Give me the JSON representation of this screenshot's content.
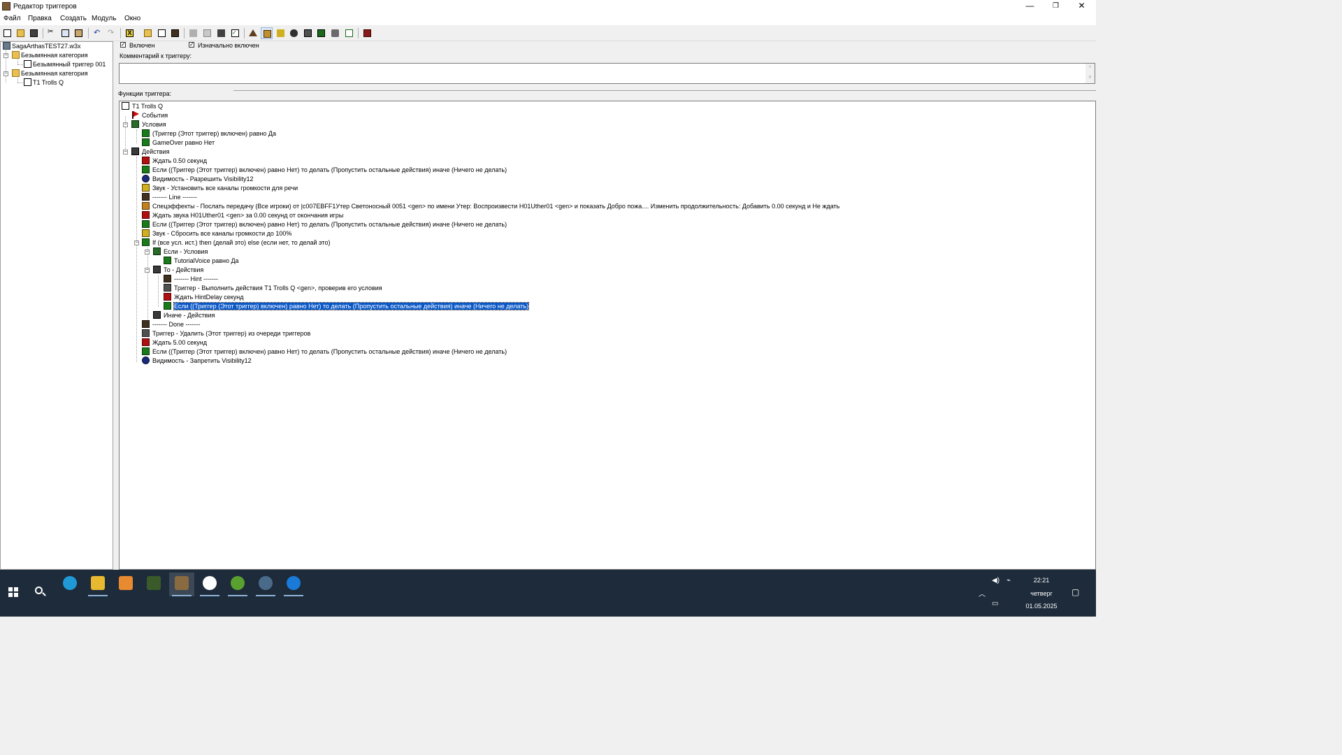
{
  "window": {
    "title": "Редактор триггеров"
  },
  "menu": [
    "Файл",
    "Правка",
    "Создать",
    "Модуль",
    "Окно"
  ],
  "left_tree": {
    "map": "SagaArthasTEST27.w3x",
    "categories": [
      {
        "label": "Безымянная категория",
        "triggers": [
          "Безымянный триггер 001"
        ]
      },
      {
        "label": "Безымянная категория",
        "triggers": [
          "T1 Trolls Q"
        ]
      }
    ]
  },
  "trigger": {
    "enabled_label": "Включен",
    "initially_on_label": "Изначально включен",
    "comment_label": "Комментарий к триггеру:",
    "comment_value": "",
    "functions_label": "Функции триггера:"
  },
  "functions": {
    "root": "T1 Trolls Q",
    "events_label": "События",
    "conditions_label": "Условия",
    "conditions": [
      "(Триггер (Этот триггер) включен) равно Да",
      "GameOver равно Нет"
    ],
    "actions_label": "Действия",
    "actions": [
      "Ждать 0.50 секунд",
      "Если ((Триггер (Этот триггер) включен) равно Нет) то делать (Пропустить остальные действия) иначе (Ничего не делать)",
      "Видимость - Разрешить Visibility12",
      "Звук - Установить все каналы громкости для речи",
      "------- Line -------",
      "Спецэффекты - Послать передачу (Все игроки) от |c007EBFF1Утер Светоносный 0051 <gen> по имени Утер: Воспроизвести H01Uther01 <gen> и показать Добро пожа.... Изменить продолжительность: Добавить 0.00 секунд и Не ждать",
      "Ждать звука H01Uther01 <gen> за 0.00 секунд от окончания игры",
      "Если ((Триггер (Этот триггер) включен) равно Нет) то делать (Пропустить остальные действия) иначе (Ничего не делать)",
      "Звук - Сбросить все каналы громкости до 100%",
      "If (все усл. ист.) then (делай это) else (если нет, то делай это)",
      "------- Done -------",
      "Триггер - Удалить (Этот триггер) из очереди триггеров",
      "Ждать 5.00 секунд",
      "Если ((Триггер (Этот триггер) включен) равно Нет) то делать (Пропустить остальные действия) иначе (Ничего не делать)",
      "Видимость - Запретить Visibility12"
    ],
    "if_block": {
      "if_label": "Если - Условия",
      "if_conditions": [
        "TutorialVoice равно Да"
      ],
      "then_label": "То - Действия",
      "then_actions": [
        "------- Hint -------",
        "Триггер - Выполнить действия T1 Trolls Q <gen>, проверив его условия",
        "Ждать HintDelay секунд",
        "Если ((Триггер (Этот триггер) включен) равно Нет) то делать (Пропустить остальные действия) иначе (Ничего не делать)"
      ],
      "else_label": "Иначе - Действия"
    }
  },
  "tray": {
    "time": "22:21",
    "day": "четверг",
    "date": "01.05.2025"
  },
  "colors": {
    "selection": "#0a58c8",
    "taskbar": "#1d2b3a"
  }
}
